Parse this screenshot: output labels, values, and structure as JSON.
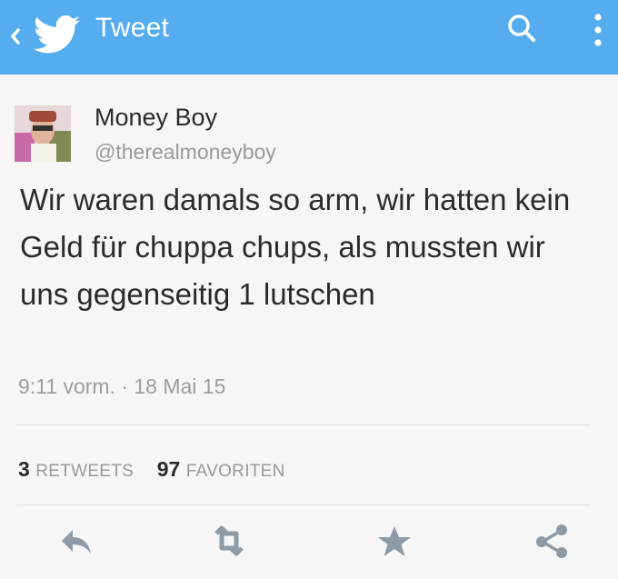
{
  "header": {
    "title": "Tweet",
    "bg_color": "#55acee",
    "icons": [
      "back-chevron-icon",
      "twitter-bird-icon",
      "search-icon",
      "more-vertical-icon"
    ]
  },
  "tweet": {
    "author_name": "Money Boy",
    "author_handle": "@therealmoneyboy",
    "text": "Wir waren damals so arm, wir hatten kein Geld für chuppa chups, als mussten wir uns gegenseitig 1 lutschen",
    "timestamp": "9:11 vorm. · 18 Mai 15"
  },
  "stats": {
    "retweets_count": "3",
    "retweets_label": "RETWEETS",
    "favorites_count": "97",
    "favorites_label": "FAVORITEN"
  },
  "actions": [
    "reply-icon",
    "retweet-icon",
    "favorite-star-icon",
    "share-icon"
  ]
}
